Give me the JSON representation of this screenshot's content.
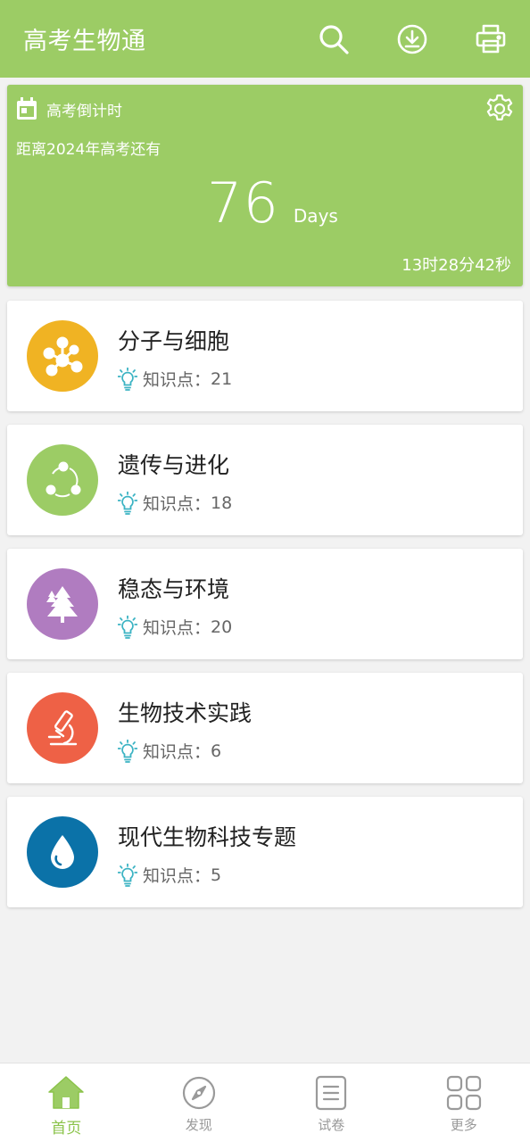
{
  "app": {
    "title": "高考生物通"
  },
  "countdown": {
    "title": "高考倒计时",
    "subtitle": "距离2024年高考还有",
    "days": "76",
    "days_unit": "Days",
    "time_left": "13时28分42秒"
  },
  "topics": [
    {
      "title": "分子与细胞",
      "meta_label": "知识点：",
      "count": "21",
      "color": "#f0b323",
      "icon": "molecule-icon"
    },
    {
      "title": "遗传与进化",
      "meta_label": "知识点：",
      "count": "18",
      "color": "#9ccc65",
      "icon": "cycle-icon"
    },
    {
      "title": "稳态与环境",
      "meta_label": "知识点：",
      "count": "20",
      "color": "#b07cc0",
      "icon": "tree-icon"
    },
    {
      "title": "生物技术实践",
      "meta_label": "知识点：",
      "count": "6",
      "color": "#ee6146",
      "icon": "microscope-icon"
    },
    {
      "title": "现代生物科技专题",
      "meta_label": "知识点：",
      "count": "5",
      "color": "#0b72a8",
      "icon": "water-drop-icon"
    }
  ],
  "nav": {
    "items": [
      {
        "label": "首页",
        "icon": "home-icon",
        "active": true
      },
      {
        "label": "发现",
        "icon": "compass-icon",
        "active": false
      },
      {
        "label": "试卷",
        "icon": "document-icon",
        "active": false
      },
      {
        "label": "更多",
        "icon": "grid-icon",
        "active": false
      }
    ]
  },
  "colors": {
    "primary": "#9ccc65",
    "active_nav": "#8bc34a",
    "bulb": "#3bb3c3"
  }
}
